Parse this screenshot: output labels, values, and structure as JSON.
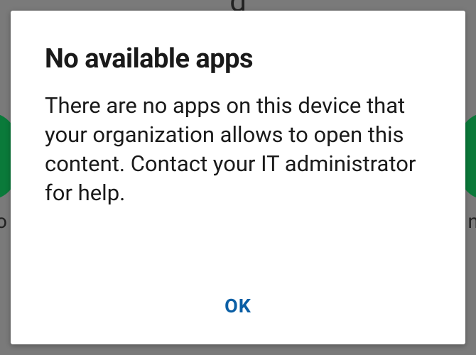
{
  "dialog": {
    "title": "No available apps",
    "message": "There are no apps on this device that your organization allows to open this content. Contact your IT administrator for help.",
    "ok_label": "OK"
  }
}
